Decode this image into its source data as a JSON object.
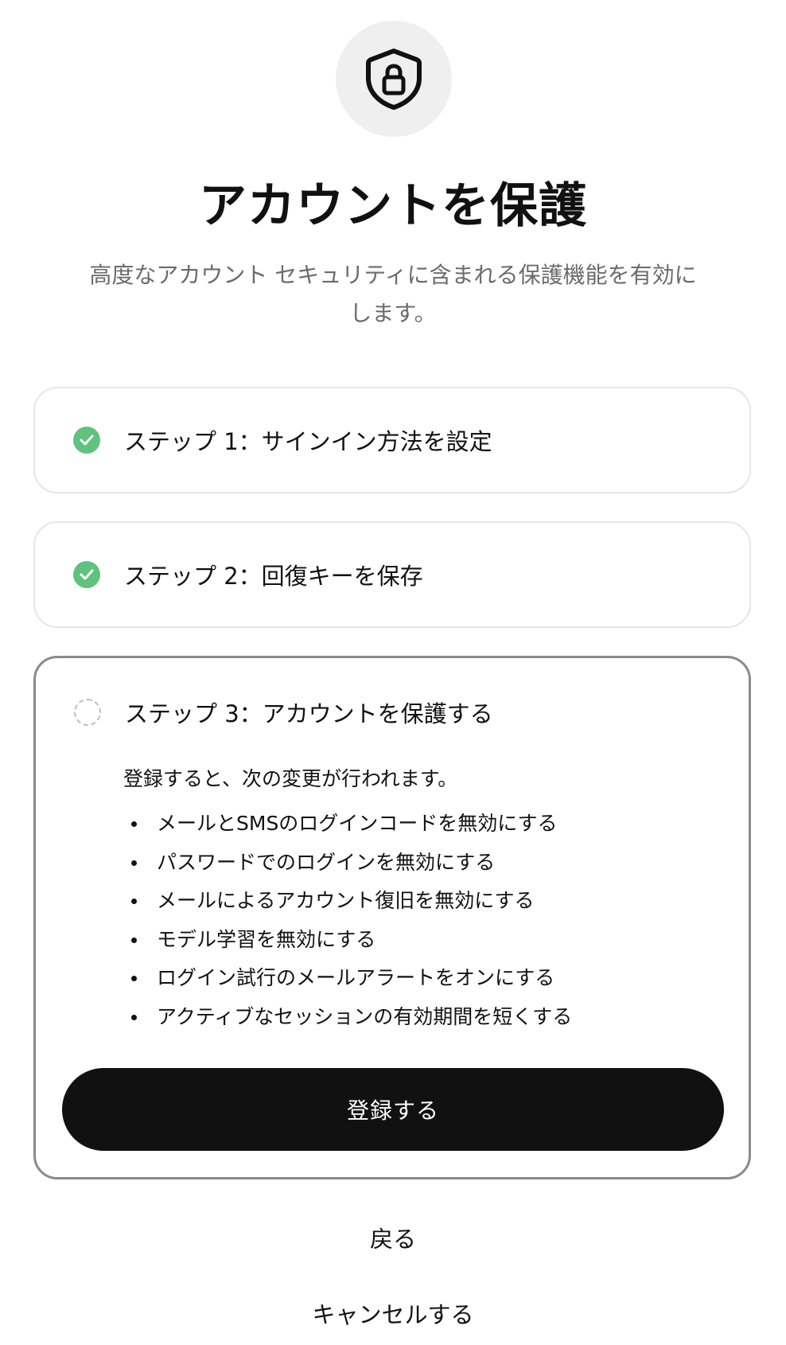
{
  "header": {
    "icon": "shield-lock-icon",
    "title": "アカウントを保護",
    "subtitle": "高度なアカウント セキュリティに含まれる保護機能を有効にします。"
  },
  "steps": [
    {
      "label": "ステップ 1：サインイン方法を設定",
      "status": "complete",
      "icon": "check-circle-icon"
    },
    {
      "label": "ステップ 2：回復キーを保存",
      "status": "complete",
      "icon": "check-circle-icon"
    },
    {
      "label": "ステップ 3：アカウントを保護する",
      "status": "pending",
      "icon": "dashed-circle-icon"
    }
  ],
  "step3": {
    "description": "登録すると、次の変更が行われます。",
    "changes": [
      "メールとSMSのログインコードを無効にする",
      "パスワードでのログインを無効にする",
      "メールによるアカウント復旧を無効にする",
      "モデル学習を無効にする",
      "ログイン試行のメールアラートをオンにする",
      "アクティブなセッションの有効期間を短くする"
    ],
    "submit_label": "登録する"
  },
  "actions": {
    "back_label": "戻る",
    "cancel_label": "キャンセルする"
  },
  "colors": {
    "accent": "#111111",
    "success": "#5fc27e",
    "icon_bg": "#efefef",
    "subtitle": "#6b6b6b",
    "card_border": "#e6e6e6",
    "active_card_border": "#8a8a8a"
  }
}
